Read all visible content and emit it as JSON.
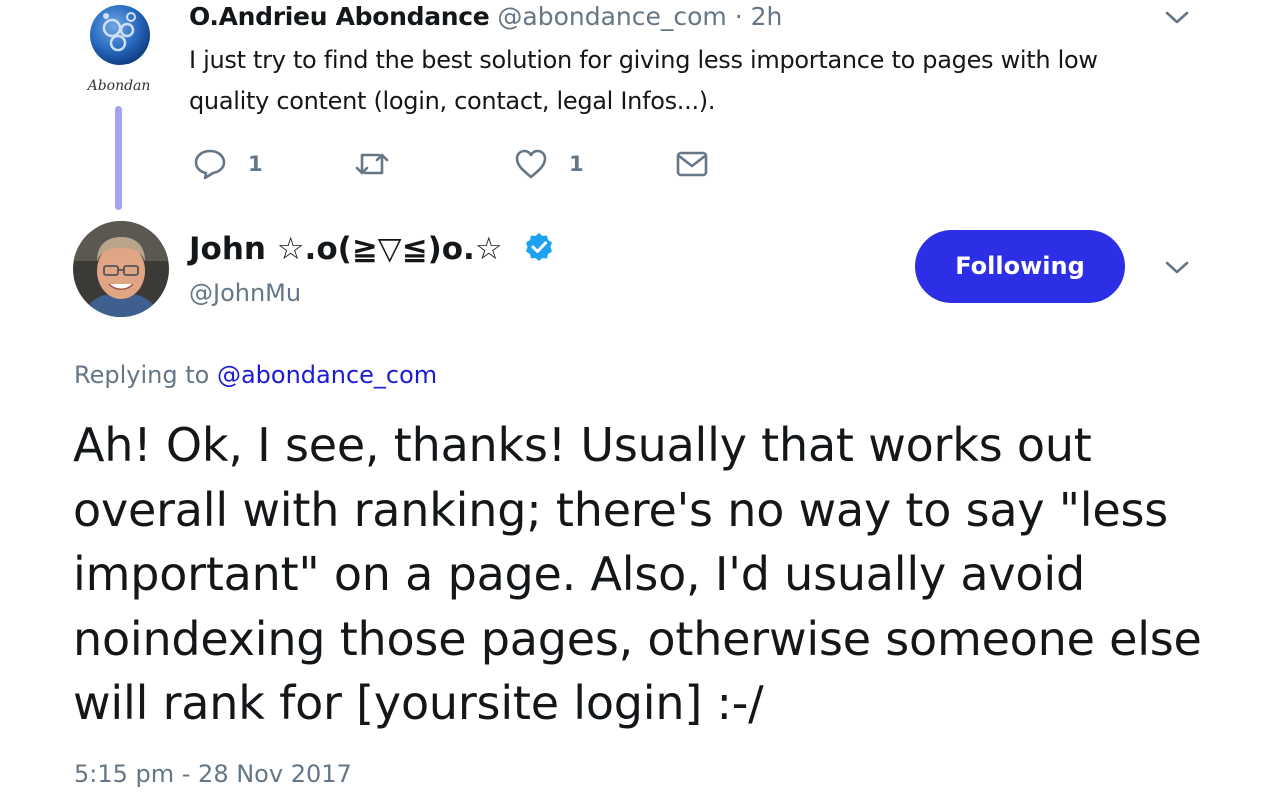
{
  "parent_tweet": {
    "author_name": "O.Andrieu Abondance",
    "handle": "@abondance_com",
    "separator": "·",
    "time": "2h",
    "text": "I just try to find the best solution for giving less importance to pages with low quality content (login, contact, legal Infos...).",
    "avatar_logo_text": "Abondan",
    "reply_count": "1",
    "retweet_count": "",
    "like_count": "1"
  },
  "main_tweet": {
    "author_name": "John ☆.o(≧▽≦)o.☆",
    "handle": "@JohnMu",
    "follow_label": "Following",
    "replying_prefix": "Replying to",
    "replying_mention": "@abondance_com",
    "text": "Ah! Ok, I see, thanks! Usually that works out overall with ranking; there's no way to say \"less important\" on a page. Also, I'd usually avoid noindexing those pages, otherwise someone else will rank for [yoursite login] :-/",
    "timestamp": "5:15 pm - 28 Nov 2017"
  },
  "colors": {
    "follow_button": "#2d2fe6",
    "thread_line": "#a4a3f0",
    "link": "#1b1bd8",
    "verified_badge": "#1da1f2",
    "muted_text": "#657786"
  },
  "icons": {
    "reply": "reply-icon",
    "retweet": "retweet-icon",
    "like": "heart-icon",
    "dm": "envelope-icon",
    "menu": "chevron-down-icon",
    "verified": "verified-badge-icon"
  }
}
